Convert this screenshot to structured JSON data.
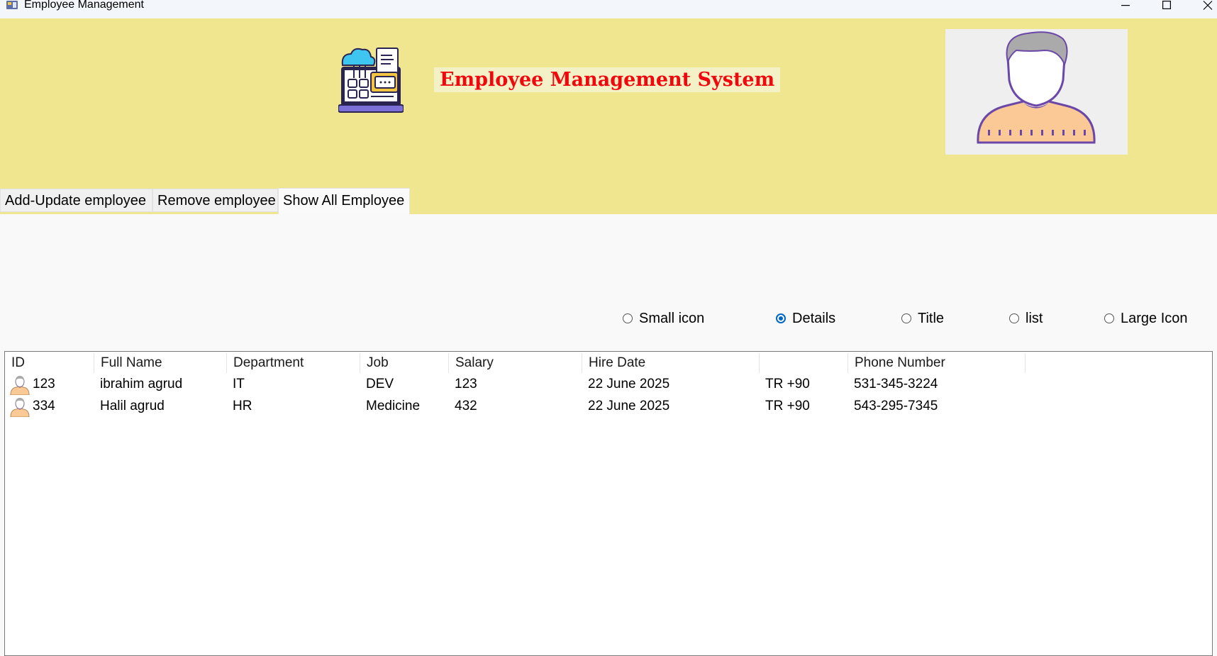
{
  "window": {
    "title": "Employee Management",
    "icons": [
      "app-icon",
      "minimize-icon",
      "maximize-icon",
      "close-icon"
    ]
  },
  "header": {
    "title": "Employee Management System",
    "logo_icon": "employee-system-logo",
    "avatar_icon": "user-avatar-image",
    "background_color": "#efe68f",
    "title_color": "#f0080e"
  },
  "tabs": [
    {
      "label": "Add-Update employee",
      "active": false
    },
    {
      "label": "Remove employee",
      "active": false
    },
    {
      "label": "Show All Employee",
      "active": true
    }
  ],
  "view_options": [
    {
      "label": "Small icon",
      "checked": false
    },
    {
      "label": "Details",
      "checked": true
    },
    {
      "label": "Title",
      "checked": false
    },
    {
      "label": "list",
      "checked": false
    },
    {
      "label": "Large Icon",
      "checked": false
    }
  ],
  "table": {
    "columns": [
      "ID",
      "Full Name",
      "Department",
      "Job",
      "Salary",
      "Hire Date",
      "",
      "Phone Number"
    ],
    "rows": [
      [
        "123",
        "ibrahim agrud",
        "IT",
        "DEV",
        "123",
        "22 June 2025",
        "TR +90",
        "531-345-3224"
      ],
      [
        "334",
        "Halil agrud",
        "HR",
        "Medicine",
        "432",
        "22 June 2025",
        "TR +90",
        "543-295-7345"
      ]
    ],
    "row_icon": "person-icon"
  }
}
